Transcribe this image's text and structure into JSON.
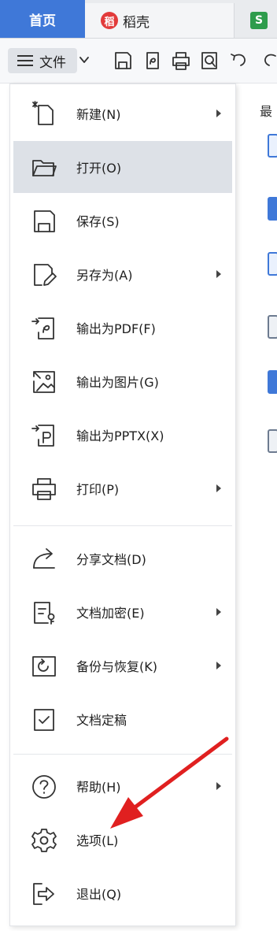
{
  "tabs": {
    "home": "首页",
    "daoke": "稻壳",
    "s_logo": "S",
    "dk_logo": "稻"
  },
  "toolbar": {
    "file_label": "文件"
  },
  "right_panel": {
    "label": "最"
  },
  "menu": {
    "items": [
      {
        "label": "新建(N)",
        "has_submenu": true
      },
      {
        "label": "打开(O)",
        "has_submenu": false,
        "active": true
      },
      {
        "label": "保存(S)",
        "has_submenu": false
      },
      {
        "label": "另存为(A)",
        "has_submenu": true
      },
      {
        "label": "输出为PDF(F)",
        "has_submenu": false
      },
      {
        "label": "输出为图片(G)",
        "has_submenu": false
      },
      {
        "label": "输出为PPTX(X)",
        "has_submenu": false
      },
      {
        "label": "打印(P)",
        "has_submenu": true
      },
      {
        "label": "分享文档(D)",
        "has_submenu": false
      },
      {
        "label": "文档加密(E)",
        "has_submenu": true
      },
      {
        "label": "备份与恢复(K)",
        "has_submenu": true
      },
      {
        "label": "文档定稿",
        "has_submenu": false
      },
      {
        "label": "帮助(H)",
        "has_submenu": true
      },
      {
        "label": "选项(L)",
        "has_submenu": false
      },
      {
        "label": "退出(Q)",
        "has_submenu": false
      }
    ]
  },
  "colors": {
    "accent": "#3f78d8",
    "arrow": "#e02020",
    "active_row": "#dde1e7"
  }
}
